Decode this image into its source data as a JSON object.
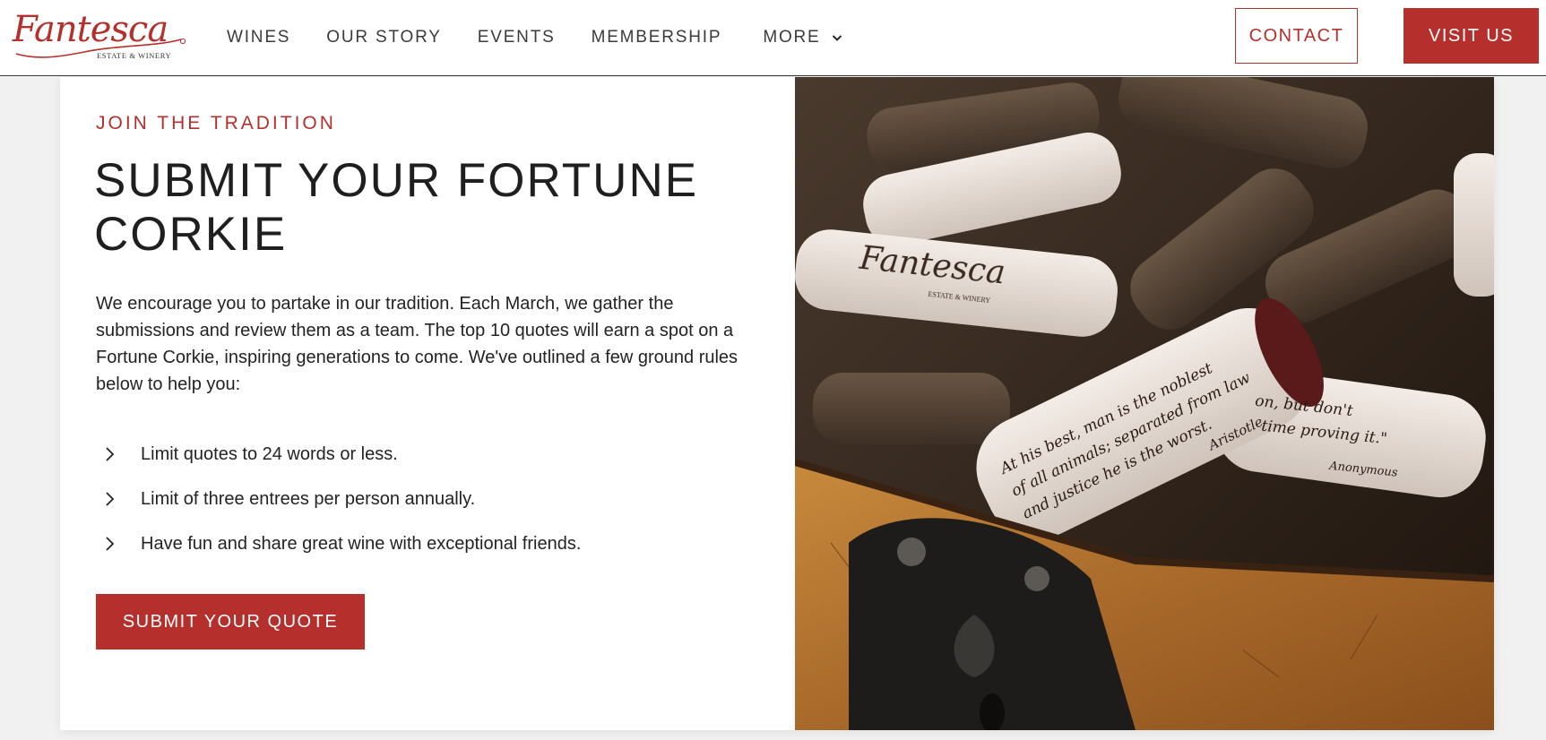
{
  "brand": {
    "logo_script": "Fantesca",
    "logo_sub": "ESTATE & WINERY"
  },
  "nav": {
    "items": [
      "WINES",
      "OUR STORY",
      "EVENTS",
      "MEMBERSHIP",
      "MORE"
    ],
    "more_icon": "chevron-down-icon"
  },
  "actions": {
    "contact": "CONTACT",
    "visit": "VISIT US"
  },
  "section": {
    "eyebrow": "JOIN THE TRADITION",
    "headline": "SUBMIT YOUR FORTUNE CORKIE",
    "body": "We encourage you to partake in our tradition. Each March, we gather the submissions and review them as a team. The top 10 quotes will earn a spot on a Fortune Corkie, inspiring generations to come. We've outlined a few ground rules below to help you:",
    "rules": [
      "Limit quotes to 24 words or less.",
      "Limit of three entrees per person annually.",
      "Have fun and share great wine with exceptional friends."
    ],
    "rule_icon": "chevron-right-icon",
    "submit": "SUBMIT YOUR QUOTE"
  },
  "photo": {
    "cork_quote_main": "At his best, man is the noblest of all animals; separated from law and justice he is the worst.",
    "cork_quote_main_author": "Aristotle",
    "cork_quote_side": "on, but don't time proving it.\"",
    "cork_quote_side_author": "Anonymous",
    "cork_brand": "Fantesca",
    "cork_brand_sub": "ESTATE & WINERY"
  },
  "colors": {
    "accent": "#b5302c",
    "text": "#232323",
    "background": "#f1f1f1"
  }
}
